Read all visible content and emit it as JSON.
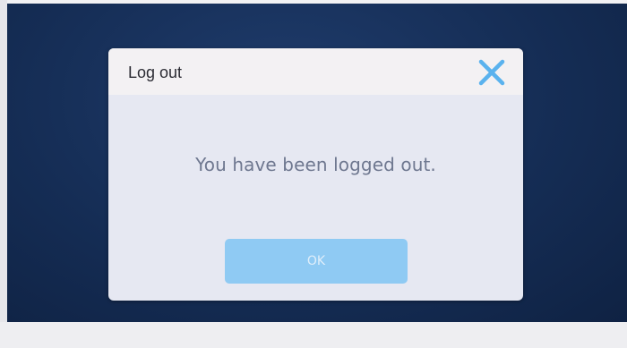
{
  "dialog": {
    "title": "Log out",
    "message": "You have been logged out.",
    "ok_label": "OK",
    "close_icon": "close-icon"
  },
  "colors": {
    "background": "#152d55",
    "dialog": "#e6e8f2",
    "header": "#f3f1f3",
    "accent": "#5ab2ee",
    "button": "#8fcaf3"
  }
}
